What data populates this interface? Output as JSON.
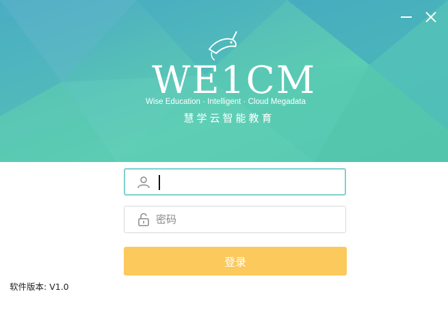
{
  "window": {
    "minimize_icon": "minimize-icon",
    "close_icon": "close-icon"
  },
  "banner": {
    "logo_text": "WE1CM",
    "tagline": "Wise Education · Intelligent · Cloud Megadata",
    "slogan": "慧学云智能教育",
    "colors": {
      "top": "#4aa6c6",
      "bottom": "#54c8ad"
    }
  },
  "form": {
    "username": {
      "value": "",
      "placeholder": "",
      "icon": "user-icon"
    },
    "password": {
      "value": "",
      "placeholder": "密码",
      "icon": "lock-icon"
    },
    "login_label": "登录"
  },
  "footer": {
    "version_label": "软件版本:",
    "version_value": "V1.0"
  },
  "colors": {
    "login_button": "#fcc95c",
    "focus_border": "#7ed0cf"
  }
}
